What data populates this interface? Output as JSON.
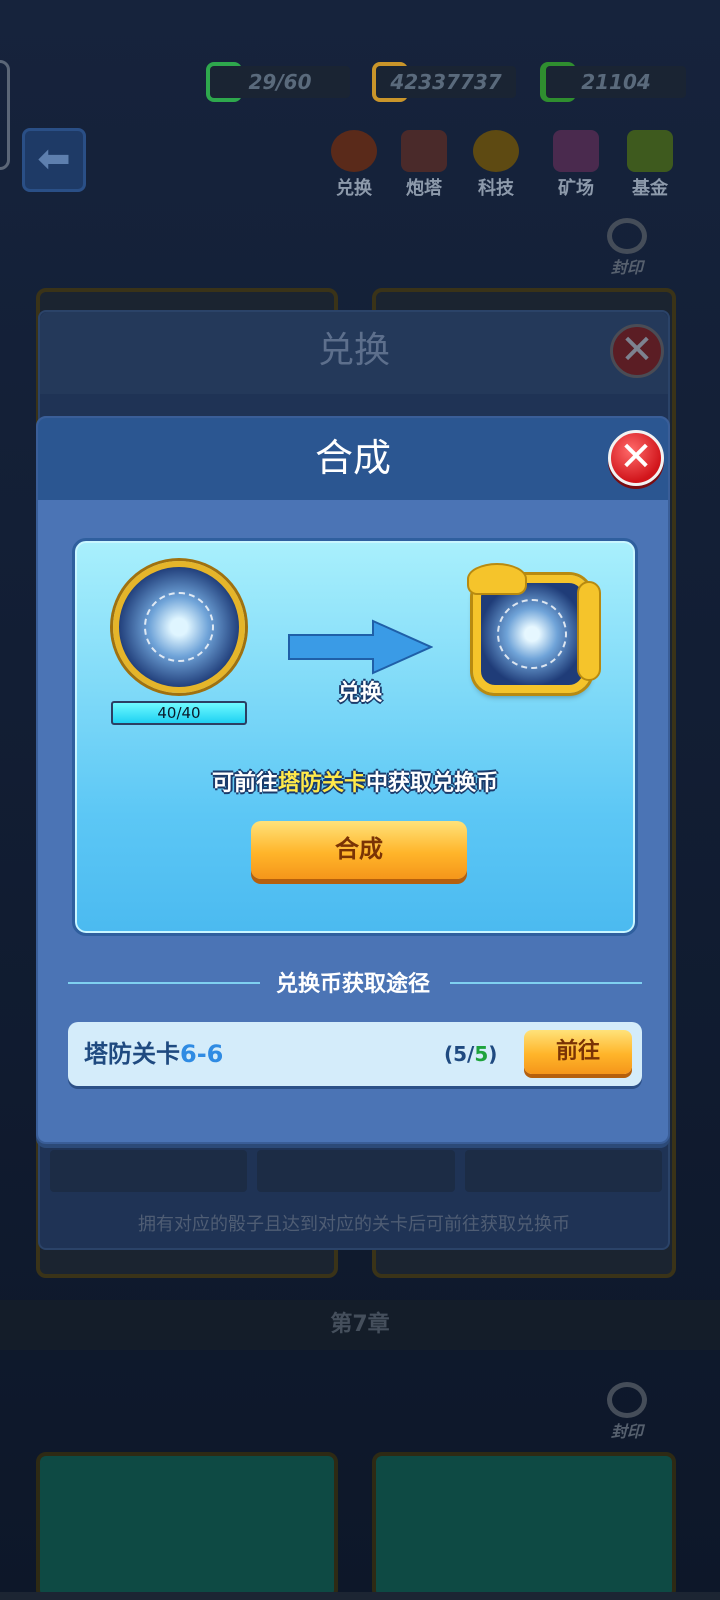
{
  "resources": [
    {
      "name": "energy",
      "value": "29/60",
      "icon_color": "#2ea84d"
    },
    {
      "name": "gold",
      "value": "42337737",
      "icon_color": "#e0a32b"
    },
    {
      "name": "gem",
      "value": "21104",
      "icon_color": "#3aa33a"
    }
  ],
  "nav": [
    {
      "label": "兑换",
      "icon": "exchange-icon"
    },
    {
      "label": "炮塔",
      "icon": "turret-icon"
    },
    {
      "label": "科技",
      "icon": "tech-icon"
    },
    {
      "label": "矿场",
      "icon": "mine-icon"
    },
    {
      "label": "基金",
      "icon": "fund-icon"
    }
  ],
  "seal_label": "封印",
  "chapter_label": "第7章",
  "exchange_dialog": {
    "title": "兑换",
    "hint": "拥有对应的骰子且达到对应的关卡后可前往获取兑换币"
  },
  "synth_dialog": {
    "title": "合成",
    "source_progress": "40/40",
    "progress_fraction": 1.0,
    "arrow_label": "兑换",
    "tip_prefix": "可前往",
    "tip_highlight": "塔防关卡",
    "tip_suffix": "中获取兑换币",
    "synth_button": "合成",
    "routes_title": "兑换币获取途径",
    "route": {
      "name": "塔防关卡",
      "stage": "6-6",
      "count_open": "(5/",
      "count_value": "5",
      "count_close": ")",
      "go_button": "前往"
    }
  },
  "colors": {
    "accent_yellow": "#ffe94a",
    "button_orange": "#ffb52a",
    "close_red": "#d1151b"
  }
}
